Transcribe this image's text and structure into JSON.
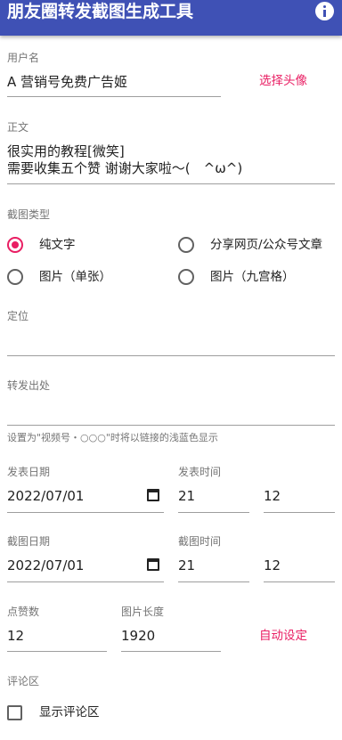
{
  "appbar": {
    "title": "朋友圈转发截图生成工具",
    "info_icon": "info-icon"
  },
  "username": {
    "label": "用户名",
    "value": "A 营销号免费广告姬",
    "avatar_button": "选择头像"
  },
  "body": {
    "label": "正文",
    "line1": "很实用的教程[微笑]",
    "line2": "需要收集五个赞 谢谢大家啦～(　^ω^)"
  },
  "screenshot_type": {
    "label": "截图类型",
    "options": [
      "纯文字",
      "分享网页/公众号文章",
      "图片（单张）",
      "图片（九宫格）"
    ],
    "selected": "纯文字"
  },
  "location": {
    "label": "定位",
    "value": ""
  },
  "source": {
    "label": "转发出处",
    "value": "",
    "helper": "设置为\"视频号・○○○\"时将以链接的浅蓝色显示"
  },
  "publish": {
    "date_label": "发表日期",
    "date_value": "2022/07/01",
    "time_label": "发表时间",
    "hour": "21",
    "minute": "12"
  },
  "capture": {
    "date_label": "截图日期",
    "date_value": "2022/07/01",
    "time_label": "截图时间",
    "hour": "21",
    "minute": "12"
  },
  "likes": {
    "label": "点赞数",
    "value": "12"
  },
  "image_length": {
    "label": "图片长度",
    "value": "1920",
    "auto_button": "自动设定"
  },
  "comments": {
    "label": "评论区",
    "checkbox_label": "显示评论区",
    "checked": false
  },
  "colors": {
    "primary": "#3f51b5",
    "accent": "#e91e63"
  }
}
